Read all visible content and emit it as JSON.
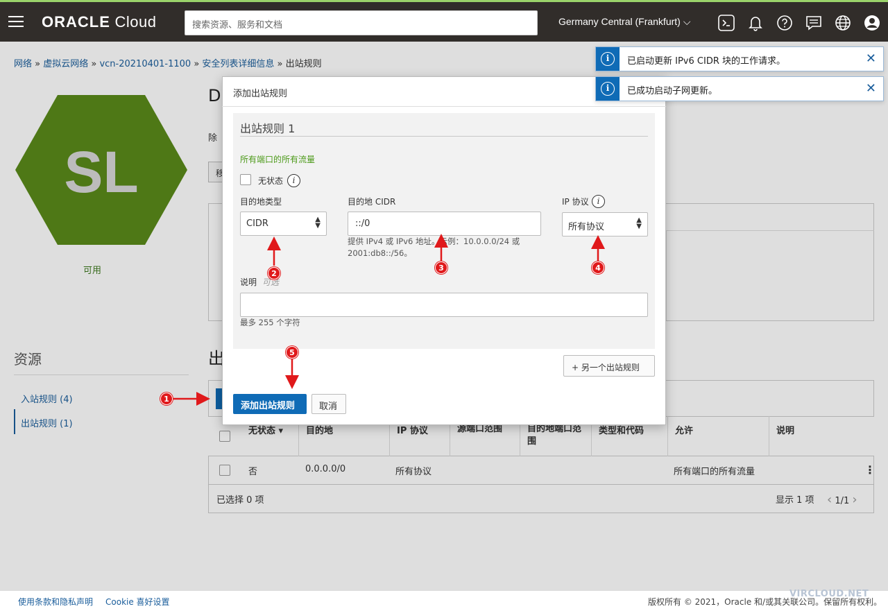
{
  "topbar": {
    "logo_strong": "ORACLE",
    "logo_light": " Cloud",
    "search_placeholder": "搜索资源、服务和文档",
    "region": "Germany Central (Frankfurt)"
  },
  "breadcrumb": {
    "items": [
      "网络",
      "虚拟云网络",
      "vcn-20210401-1100",
      "安全列表详细信息"
    ],
    "separator": " » ",
    "current": "出站规则"
  },
  "resource": {
    "avatar_initials": "SL",
    "status": "可用",
    "title_initial": "D",
    "desc_initial": "除",
    "button_initial": "移"
  },
  "resources_nav": {
    "title": "资源",
    "items": [
      {
        "label": "入站规则 (4)",
        "active": false
      },
      {
        "label": "出站规则 (1)",
        "active": true
      }
    ]
  },
  "section_title_initial": "出",
  "table": {
    "columns": [
      "无状态",
      "目的地",
      "IP 协议",
      "源端口范围",
      "目的地端口范围",
      "类型和代码",
      "允许",
      "说明"
    ],
    "sort_indicator": "▾",
    "rows": [
      {
        "stateless": "否",
        "destination": "0.0.0.0/0",
        "protocol": "所有协议",
        "src_port": "",
        "dst_port": "",
        "type_code": "",
        "allows": "所有端口的所有流量",
        "description": ""
      }
    ],
    "selected": "已选择 0 项",
    "showing": "显示 1 项",
    "page": "1/1"
  },
  "dialog": {
    "title": "添加出站规则",
    "rule_title": "出站规则 1",
    "allows_text": "所有端口的所有流量",
    "stateless_label": "无状态",
    "dest_type_label": "目的地类型",
    "dest_type_value": "CIDR",
    "dest_cidr_label": "目的地 CIDR",
    "dest_cidr_value": "::/0",
    "dest_cidr_hint": "提供 IPv4 或 IPv6 地址。示例：10.0.0.0/24 或 2001:db8::/56。",
    "ip_protocol_label": "IP 协议",
    "ip_protocol_value": "所有协议",
    "description_label": "说明",
    "description_optional": "可选",
    "description_value": "",
    "description_hint": "最多 255 个字符",
    "another_rule_button": "+ 另一个出站规则",
    "submit_button": "添加出站规则",
    "cancel_button": "取消"
  },
  "toasts": [
    {
      "text": "已启动更新 IPv6 CIDR 块的工作请求。"
    },
    {
      "text": "已成功启动子网更新。"
    }
  ],
  "annotations": [
    "1",
    "2",
    "3",
    "4",
    "5"
  ],
  "footer": {
    "terms": "使用条款和隐私声明",
    "cookie": "Cookie 喜好设置",
    "copyright": "版权所有 © 2021，Oracle 和/或其关联公司。保留所有权利。",
    "watermark": "VIRCLOUD.NET"
  },
  "colors": {
    "topbar": "#312d2a",
    "accent_green": "#9ad36a",
    "primary_blue": "#0f6bb6",
    "avatar_green": "#5a8a1a",
    "annotation_red": "#e0191b"
  }
}
